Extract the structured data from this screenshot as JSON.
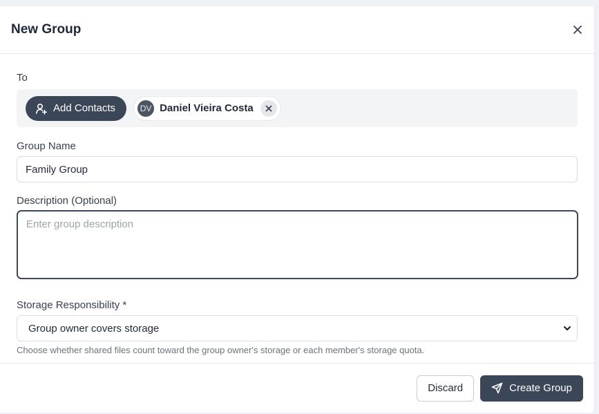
{
  "header": {
    "title": "New Group",
    "close_icon": "close-icon"
  },
  "recipients": {
    "label": "To",
    "add_contacts_label": "Add Contacts",
    "add_contacts_icon": "user-plus-icon",
    "contacts": [
      {
        "initials": "DV",
        "name": "Daniel Vieira Costa"
      }
    ]
  },
  "group_name": {
    "label": "Group Name",
    "value": "Family Group"
  },
  "description": {
    "label": "Description (Optional)",
    "value": "",
    "placeholder": "Enter group description"
  },
  "storage": {
    "label": "Storage Responsibility *",
    "selected": "Group owner covers storage",
    "hint": "Choose whether shared files count toward the group owner's storage or each member's storage quota."
  },
  "footer": {
    "discard_label": "Discard",
    "create_label": "Create Group",
    "create_icon": "send-icon"
  },
  "colors": {
    "accent": "#3b4658",
    "chip_bg": "#f3f4f6"
  }
}
